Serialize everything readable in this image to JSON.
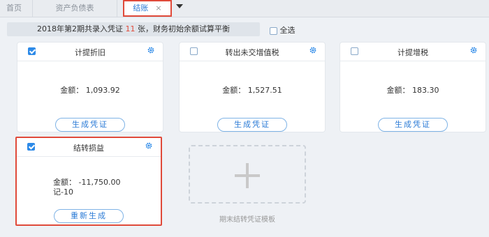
{
  "tabs": {
    "home": "首页",
    "balance_sheet": "资产负债表",
    "active": "结账",
    "close_glyph": "×"
  },
  "info": {
    "prefix": "2018年第2期共录入凭证",
    "count": "11",
    "suffix": "张，财务初始余额试算平衡"
  },
  "select_all": "全选",
  "cards": [
    {
      "title": "计提折旧",
      "checked": true,
      "amount_label": "金额：",
      "amount": "1,093.92",
      "button": "生成凭证"
    },
    {
      "title": "转出未交增值税",
      "checked": false,
      "amount_label": "金额：",
      "amount": "1,527.51",
      "button": "生成凭证"
    },
    {
      "title": "计提增税",
      "checked": false,
      "amount_label": "金额：",
      "amount": "183.30",
      "button": "生成凭证"
    },
    {
      "title": "结转损益",
      "checked": true,
      "amount_label": "金额：",
      "amount": "-11,750.00",
      "voucher": "记-10",
      "button": "重新生成"
    }
  ],
  "template_label": "期末结转凭证模板",
  "colors": {
    "accent": "#2b7bd6",
    "highlight": "#e04a3a",
    "checkbox": "#2d8ae8"
  }
}
